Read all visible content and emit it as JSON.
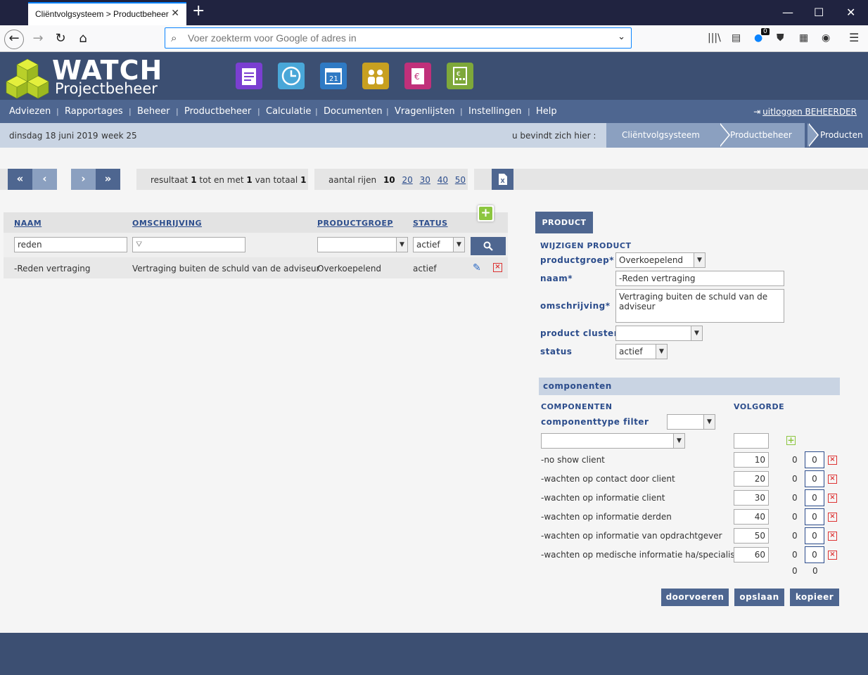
{
  "browser": {
    "tab_title": "Cliëntvolgsysteem > Productbeheer",
    "url_placeholder": "Voer zoekterm voor Google of adres in",
    "badge": "0"
  },
  "header": {
    "logo_title": "WATCH",
    "logo_subtitle": "Projectbeheer"
  },
  "menu": {
    "items": [
      "Adviezen",
      "Rapportages",
      "Beheer",
      "Productbeheer",
      "Calculatie",
      "Documenten",
      "Vragenlijsten",
      "Instellingen",
      "Help"
    ],
    "logout": "uitloggen BEHEERDER"
  },
  "infobar": {
    "date": "dinsdag 18 juni 2019",
    "week": "week 25",
    "here": "u bevindt zich hier :",
    "breadcrumbs": [
      "Cliëntvolgsysteem",
      "Productbeheer",
      "Producten"
    ]
  },
  "pager": {
    "result_prefix": "resultaat",
    "from": "1",
    "to_label": "tot en met",
    "to": "1",
    "total_label": "van totaal",
    "total": "1",
    "rows_label": "aantal rijen",
    "rows_current": "10",
    "rows_options": [
      "20",
      "30",
      "40",
      "50"
    ]
  },
  "list": {
    "columns": [
      "NAAM",
      "OMSCHRIJVING",
      "PRODUCTGROEP",
      "STATUS"
    ],
    "filter_name": "reden",
    "filter_status": "actief",
    "rows": [
      {
        "naam": "-Reden vertraging",
        "omschrijving": "Vertraging buiten de schuld van de adviseur",
        "productgroep": "Overkoepelend",
        "status": "actief"
      }
    ]
  },
  "form": {
    "tab": "PRODUCT",
    "heading": "WIJZIGEN PRODUCT",
    "labels": {
      "productgroep": "productgroep*",
      "naam": "naam*",
      "omschrijving": "omschrijving*",
      "cluster": "product cluster",
      "status": "status"
    },
    "values": {
      "productgroep": "Overkoepelend",
      "naam": "-Reden vertraging",
      "omschrijving": "Vertraging buiten de schuld van de adviseur",
      "cluster": "",
      "status": "actief"
    }
  },
  "components": {
    "section_title": "componenten",
    "col_components": "COMPONENTEN",
    "col_order": "VOLGORDE",
    "filter_label": "componenttype filter",
    "rows": [
      {
        "name": "-no show client",
        "order": "10",
        "a": "0",
        "b": "0"
      },
      {
        "name": "-wachten op contact door client",
        "order": "20",
        "a": "0",
        "b": "0"
      },
      {
        "name": "-wachten op informatie client",
        "order": "30",
        "a": "0",
        "b": "0"
      },
      {
        "name": "-wachten op informatie derden",
        "order": "40",
        "a": "0",
        "b": "0"
      },
      {
        "name": "-wachten op informatie van opdrachtgever",
        "order": "50",
        "a": "0",
        "b": "0"
      },
      {
        "name": "-wachten op medische informatie ha/specialist",
        "order": "60",
        "a": "0",
        "b": "0"
      }
    ],
    "totals": [
      "0",
      "0"
    ]
  },
  "actions": {
    "doorvoeren": "doorvoeren",
    "opslaan": "opslaan",
    "kopieer": "kopieer"
  }
}
